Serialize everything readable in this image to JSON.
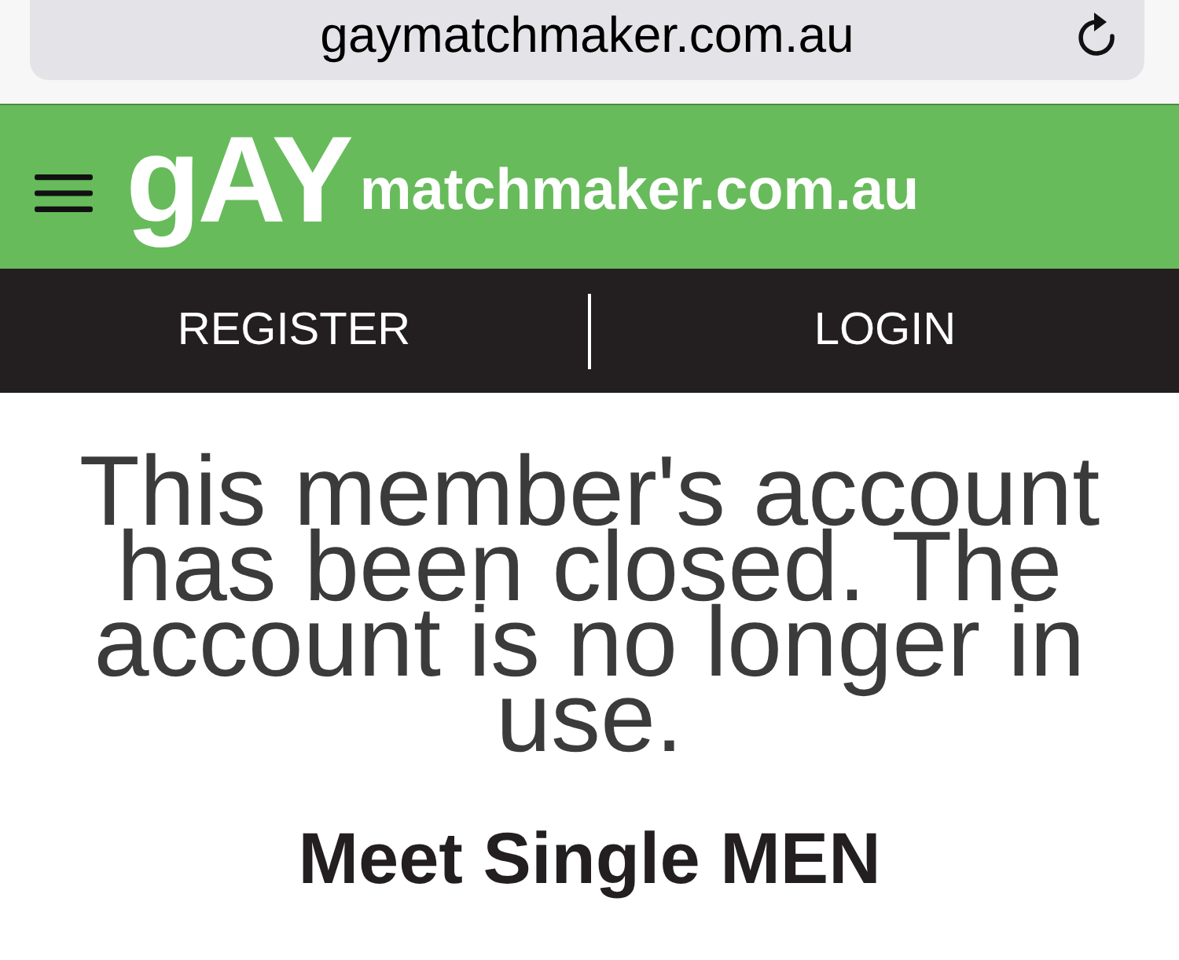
{
  "browser": {
    "url": "gaymatchmaker.com.au"
  },
  "header": {
    "logo": {
      "mark": "gAY",
      "wordmark": "matchmaker.com.au"
    }
  },
  "nav": {
    "items": [
      {
        "label": "REGISTER"
      },
      {
        "label": "LOGIN"
      }
    ]
  },
  "notice": {
    "message": "This member's account has been closed. The account is no longer in use.",
    "heading": "Meet Single MEN"
  }
}
